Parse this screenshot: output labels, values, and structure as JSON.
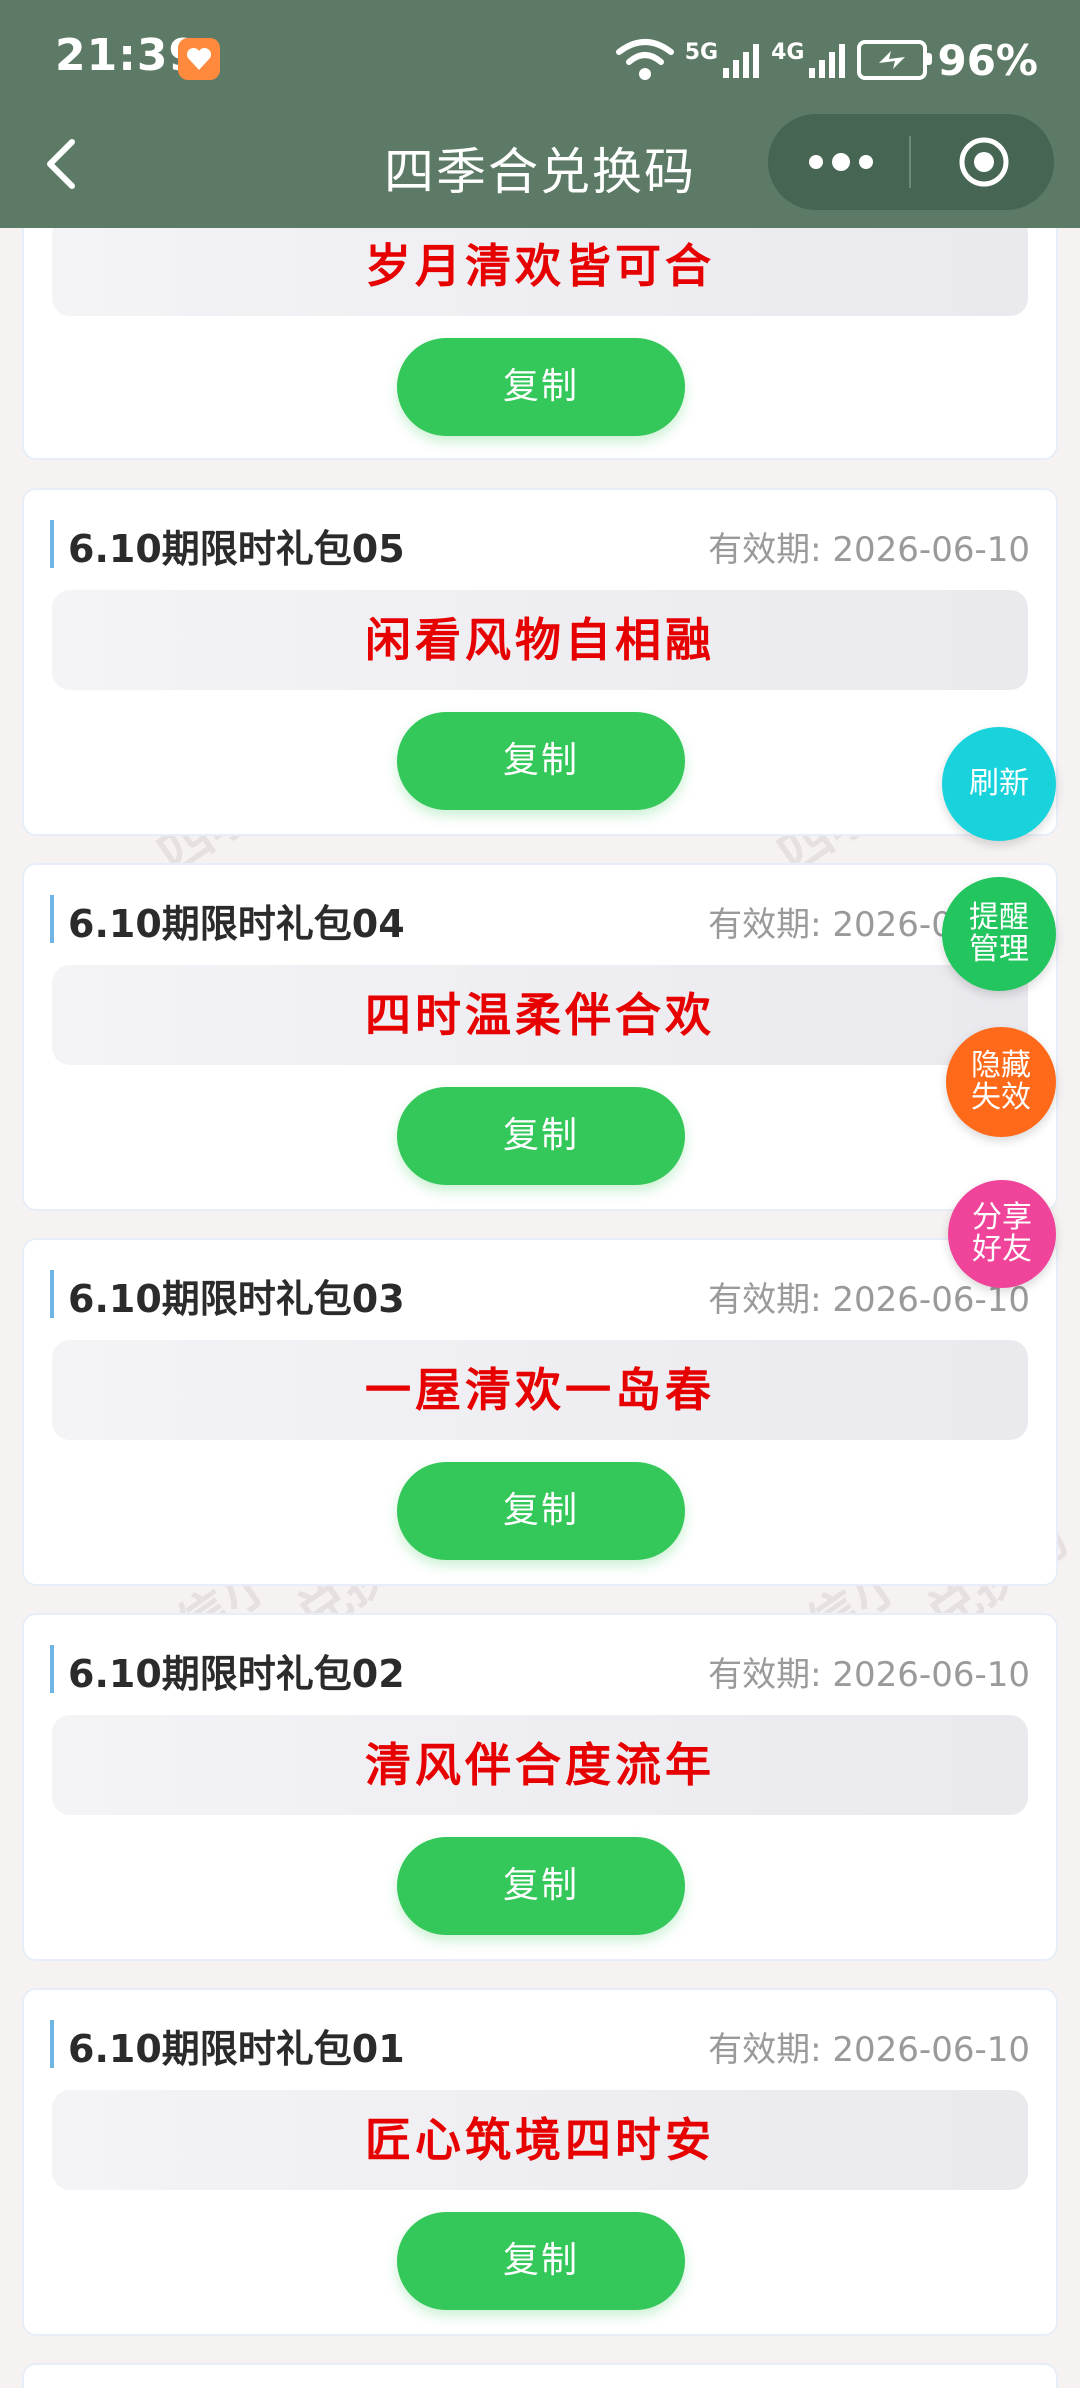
{
  "status_bar": {
    "time": "21:39",
    "network_5g": "5G",
    "network_4g": "4G",
    "battery": "96%"
  },
  "nav": {
    "title": "四季合兑换码",
    "more_icon": "more-dots-icon",
    "close_icon": "target-icon"
  },
  "top_card": {
    "code": "岁月清欢皆可合",
    "copy_label": "复制"
  },
  "cards": [
    {
      "name": "6.10期限时礼包05",
      "date": "有效期: 2026-06-10",
      "code": "闲看风物自相融",
      "copy_label": "复制"
    },
    {
      "name": "6.10期限时礼包04",
      "date": "有效期: 2026-06-10",
      "code": "四时温柔伴合欢",
      "copy_label": "复制"
    },
    {
      "name": "6.10期限时礼包03",
      "date": "有效期: 2026-06-10",
      "code": "一屋清欢一岛春",
      "copy_label": "复制"
    },
    {
      "name": "6.10期限时礼包02",
      "date": "有效期: 2026-06-10",
      "code": "清风伴合度流年",
      "copy_label": "复制"
    },
    {
      "name": "6.10期限时礼包01",
      "date": "有效期: 2026-06-10",
      "code": "匠心筑境四时安",
      "copy_label": "复制"
    }
  ],
  "watermark": {
    "line1": "微信小程序",
    "line2": "四季合兑换码"
  },
  "fabs": {
    "refresh": "刷新",
    "remind_1": "提醒",
    "remind_2": "管理",
    "hide_1": "隐藏",
    "hide_2": "失效",
    "share_1": "分享",
    "share_2": "好友"
  },
  "colors": {
    "nav_bg": "#5c7a66",
    "code_text": "#e60000",
    "copy_btn": "#34c759",
    "fab_refresh": "#19d3dc",
    "fab_remind": "#22c55e",
    "fab_hide": "#ff6a1a",
    "fab_share": "#f0449a"
  }
}
